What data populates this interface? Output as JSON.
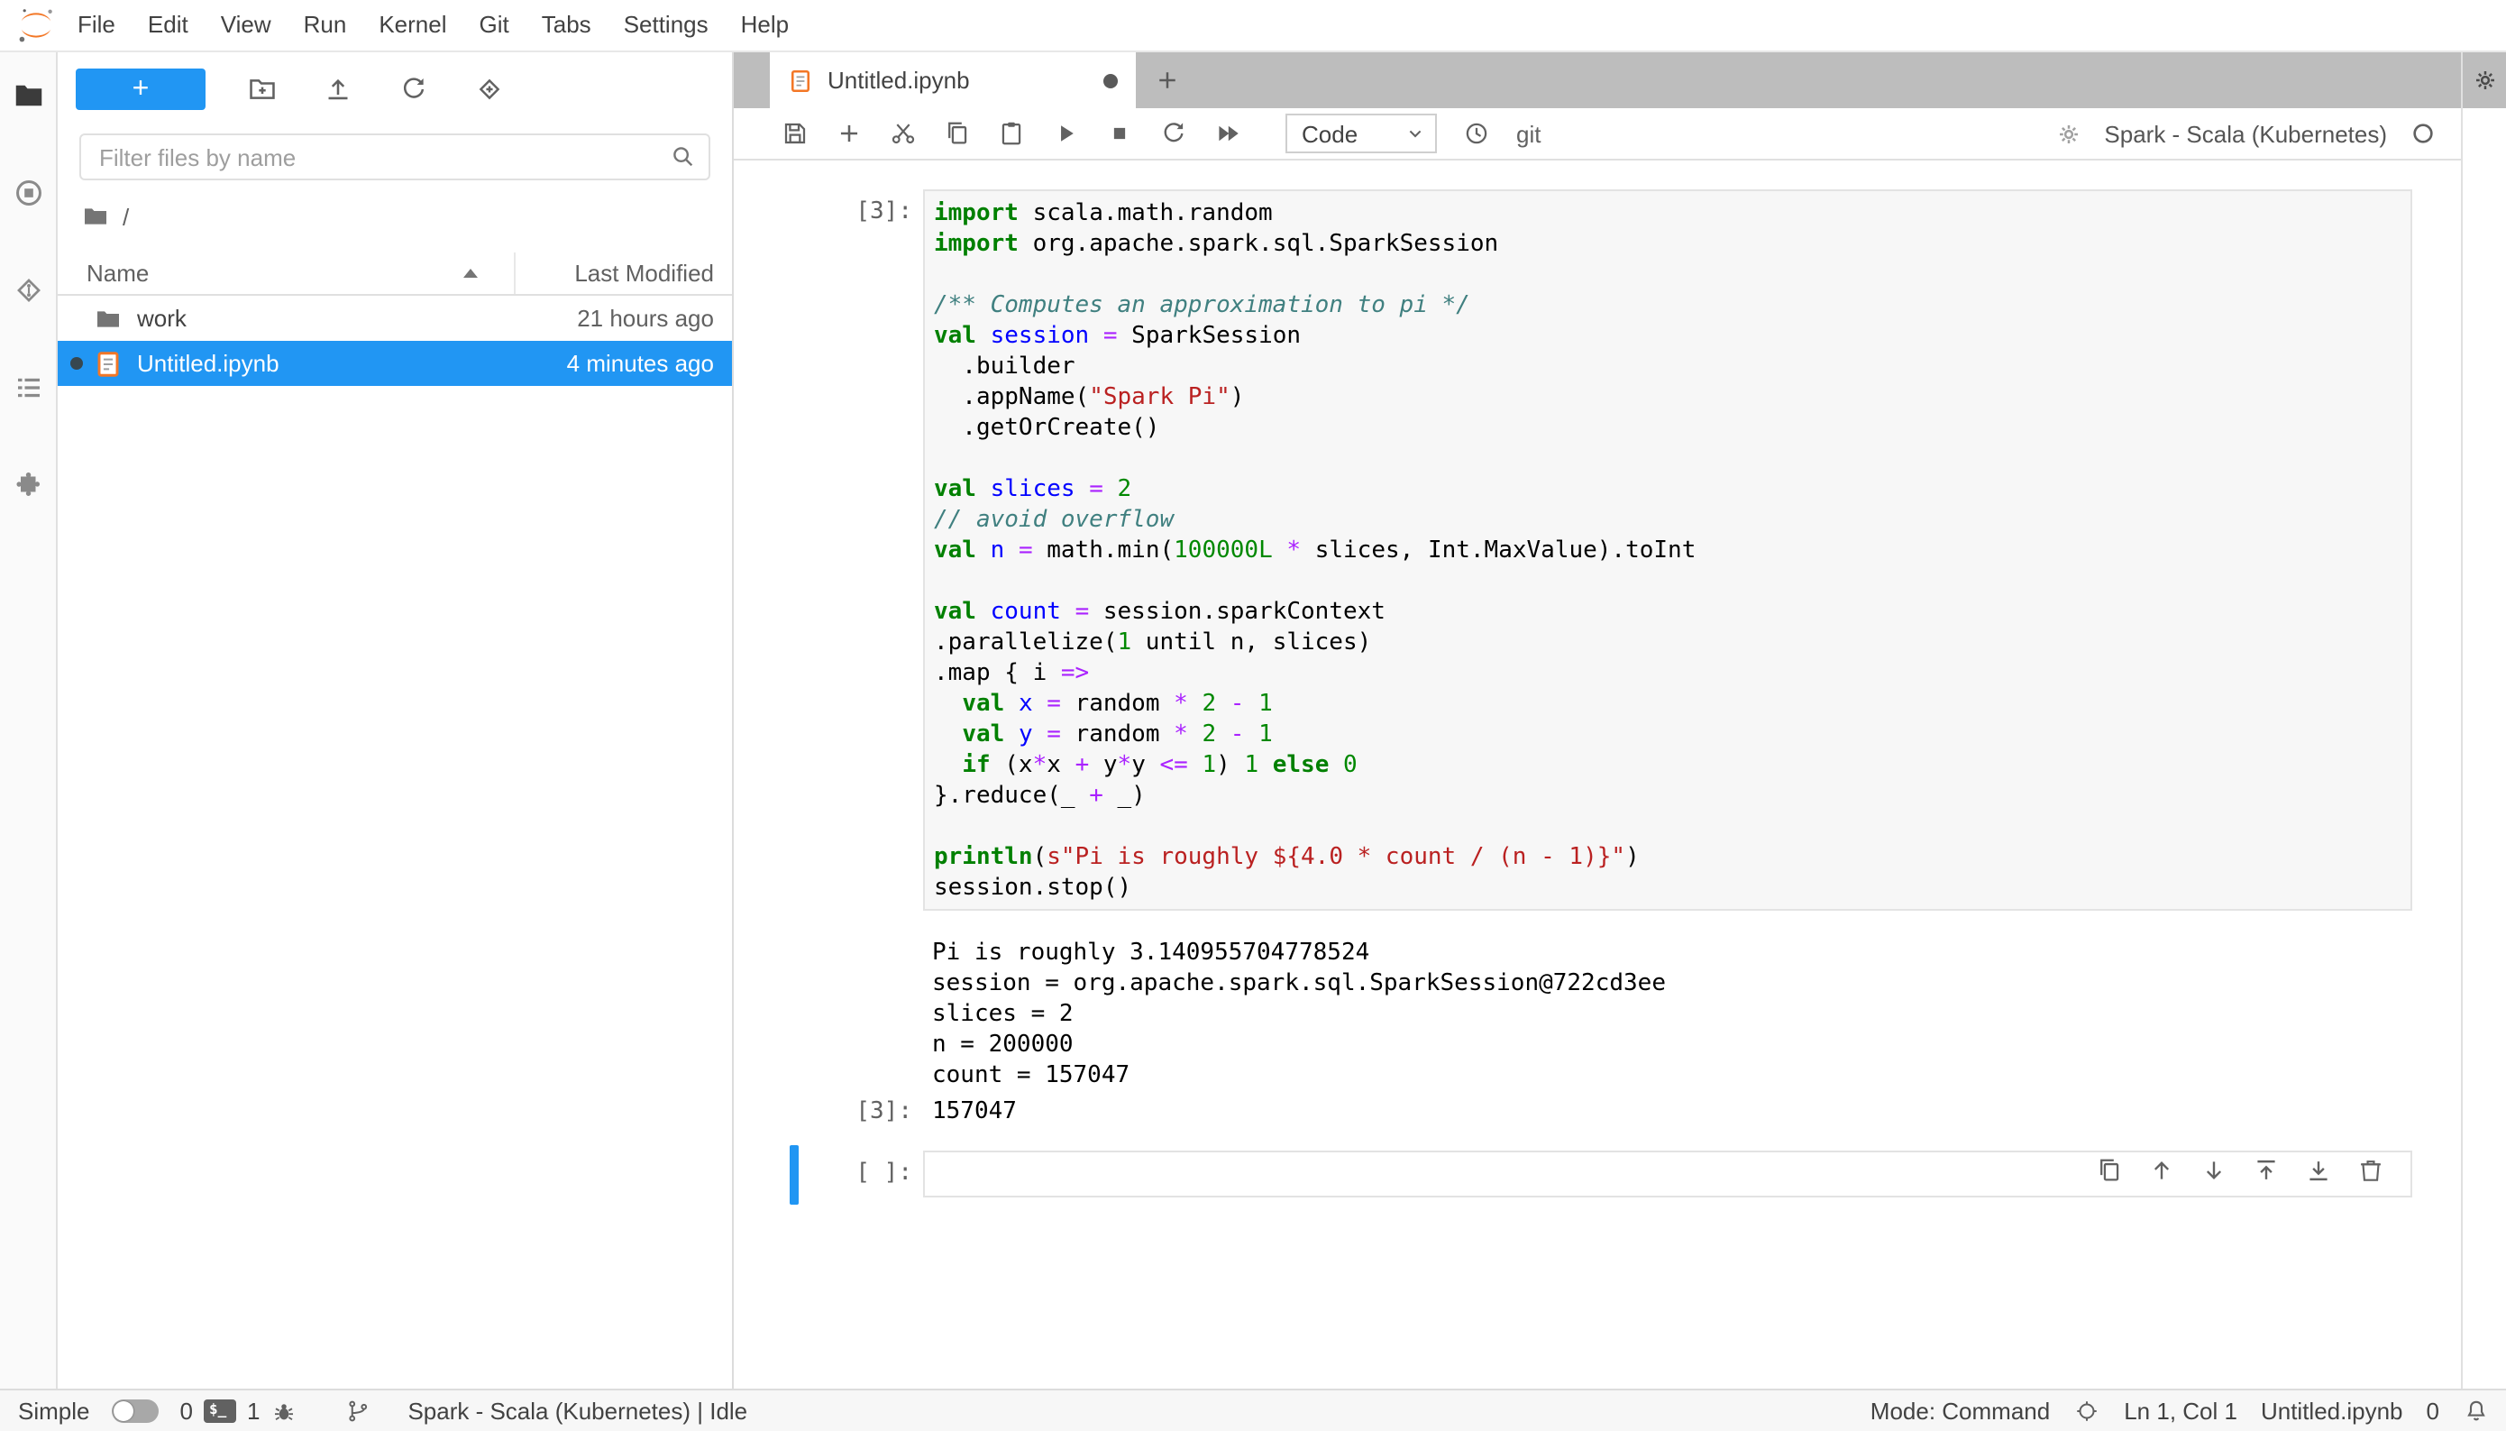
{
  "colors": {
    "accent": "#2196f3",
    "brand_orange": "#f37726",
    "tab_bar_bg": "#bdbdbd",
    "syntax_keyword": "#008000",
    "syntax_def": "#0000ff",
    "syntax_operator": "#aa22ff",
    "syntax_string": "#ba2121",
    "syntax_comment": "#408080",
    "syntax_number": "#008800"
  },
  "menubar": {
    "items": [
      "File",
      "Edit",
      "View",
      "Run",
      "Kernel",
      "Git",
      "Tabs",
      "Settings",
      "Help"
    ]
  },
  "left_sidebar": {
    "icons": [
      "files-icon",
      "running-sessions-icon",
      "git-icon",
      "table-of-contents-icon",
      "extensions-icon"
    ]
  },
  "file_browser": {
    "new_button_label": "+",
    "filter_placeholder": "Filter files by name",
    "breadcrumb_root": "/",
    "columns": {
      "name": "Name",
      "modified": "Last Modified"
    },
    "rows": [
      {
        "name": "work",
        "modified": "21 hours ago",
        "type": "folder",
        "selected": false,
        "running": false
      },
      {
        "name": "Untitled.ipynb",
        "modified": "4 minutes ago",
        "type": "notebook",
        "selected": true,
        "running": true
      }
    ]
  },
  "dock": {
    "tab": {
      "label": "Untitled.ipynb",
      "dirty": true
    },
    "toolbar": {
      "cell_type": "Code",
      "git_label": "git",
      "kernel_name": "Spark - Scala (Kubernetes)"
    }
  },
  "notebook": {
    "code_cell": {
      "execution_prompt": "[3]:",
      "result_prompt": "[3]:",
      "lines": [
        [
          [
            "k",
            "import"
          ],
          [
            "p",
            " scala.math.random"
          ]
        ],
        [
          [
            "k",
            "import"
          ],
          [
            "p",
            " org.apache.spark.sql.SparkSession"
          ]
        ],
        [],
        [
          [
            "c",
            "/** Computes an approximation to pi */"
          ]
        ],
        [
          [
            "k",
            "val"
          ],
          [
            "p",
            " "
          ],
          [
            "d",
            "session"
          ],
          [
            "p",
            " "
          ],
          [
            "o",
            "="
          ],
          [
            "p",
            " SparkSession"
          ]
        ],
        [
          [
            "p",
            "  .builder"
          ]
        ],
        [
          [
            "p",
            "  .appName("
          ],
          [
            "s",
            "\"Spark Pi\""
          ],
          [
            "p",
            ")"
          ]
        ],
        [
          [
            "p",
            "  .getOrCreate()"
          ]
        ],
        [],
        [
          [
            "k",
            "val"
          ],
          [
            "p",
            " "
          ],
          [
            "d",
            "slices"
          ],
          [
            "p",
            " "
          ],
          [
            "o",
            "="
          ],
          [
            "p",
            " "
          ],
          [
            "n",
            "2"
          ]
        ],
        [
          [
            "c",
            "// avoid overflow"
          ]
        ],
        [
          [
            "k",
            "val"
          ],
          [
            "p",
            " "
          ],
          [
            "d",
            "n"
          ],
          [
            "p",
            " "
          ],
          [
            "o",
            "="
          ],
          [
            "p",
            " math.min("
          ],
          [
            "n",
            "100000L"
          ],
          [
            "p",
            " "
          ],
          [
            "o",
            "*"
          ],
          [
            "p",
            " slices, Int.MaxValue).toInt"
          ]
        ],
        [],
        [
          [
            "k",
            "val"
          ],
          [
            "p",
            " "
          ],
          [
            "d",
            "count"
          ],
          [
            "p",
            " "
          ],
          [
            "o",
            "="
          ],
          [
            "p",
            " session.sparkContext"
          ]
        ],
        [
          [
            "p",
            ".parallelize("
          ],
          [
            "n",
            "1"
          ],
          [
            "p",
            " until n, slices)"
          ]
        ],
        [
          [
            "p",
            ".map { i "
          ],
          [
            "o",
            "=>"
          ]
        ],
        [
          [
            "p",
            "  "
          ],
          [
            "k",
            "val"
          ],
          [
            "p",
            " "
          ],
          [
            "d",
            "x"
          ],
          [
            "p",
            " "
          ],
          [
            "o",
            "="
          ],
          [
            "p",
            " random "
          ],
          [
            "o",
            "*"
          ],
          [
            "p",
            " "
          ],
          [
            "n",
            "2"
          ],
          [
            "p",
            " "
          ],
          [
            "o",
            "-"
          ],
          [
            "p",
            " "
          ],
          [
            "n",
            "1"
          ]
        ],
        [
          [
            "p",
            "  "
          ],
          [
            "k",
            "val"
          ],
          [
            "p",
            " "
          ],
          [
            "d",
            "y"
          ],
          [
            "p",
            " "
          ],
          [
            "o",
            "="
          ],
          [
            "p",
            " random "
          ],
          [
            "o",
            "*"
          ],
          [
            "p",
            " "
          ],
          [
            "n",
            "2"
          ],
          [
            "p",
            " "
          ],
          [
            "o",
            "-"
          ],
          [
            "p",
            " "
          ],
          [
            "n",
            "1"
          ]
        ],
        [
          [
            "p",
            "  "
          ],
          [
            "k",
            "if"
          ],
          [
            "p",
            " (x"
          ],
          [
            "o",
            "*"
          ],
          [
            "p",
            "x "
          ],
          [
            "o",
            "+"
          ],
          [
            "p",
            " y"
          ],
          [
            "o",
            "*"
          ],
          [
            "p",
            "y "
          ],
          [
            "o",
            "<="
          ],
          [
            "p",
            " "
          ],
          [
            "n",
            "1"
          ],
          [
            "p",
            ") "
          ],
          [
            "n",
            "1"
          ],
          [
            "p",
            " "
          ],
          [
            "k",
            "else"
          ],
          [
            "p",
            " "
          ],
          [
            "n",
            "0"
          ]
        ],
        [
          [
            "p",
            "}.reduce(_ "
          ],
          [
            "o",
            "+"
          ],
          [
            "p",
            " _)"
          ]
        ],
        [],
        [
          [
            "k",
            "println"
          ],
          [
            "p",
            "("
          ],
          [
            "s",
            "s\"Pi is roughly ${4.0 * count / (n - 1)}\""
          ],
          [
            "p",
            ")"
          ]
        ],
        [
          [
            "p",
            "session.stop()"
          ]
        ]
      ],
      "output_lines": [
        "Pi is roughly 3.140955704778524",
        "session = org.apache.spark.sql.SparkSession@722cd3ee",
        "slices = 2",
        "n = 200000",
        "count = 157047"
      ],
      "result": "157047"
    },
    "empty_cell": {
      "prompt": "[ ]:"
    }
  },
  "status_bar": {
    "simple_label": "Simple",
    "terminals_count": "0",
    "kernels_count": "1",
    "kernel_status": "Spark - Scala (Kubernetes) | Idle",
    "mode": "Mode: Command",
    "cursor_position": "Ln 1, Col 1",
    "active_file": "Untitled.ipynb",
    "notifications_count": "0"
  }
}
